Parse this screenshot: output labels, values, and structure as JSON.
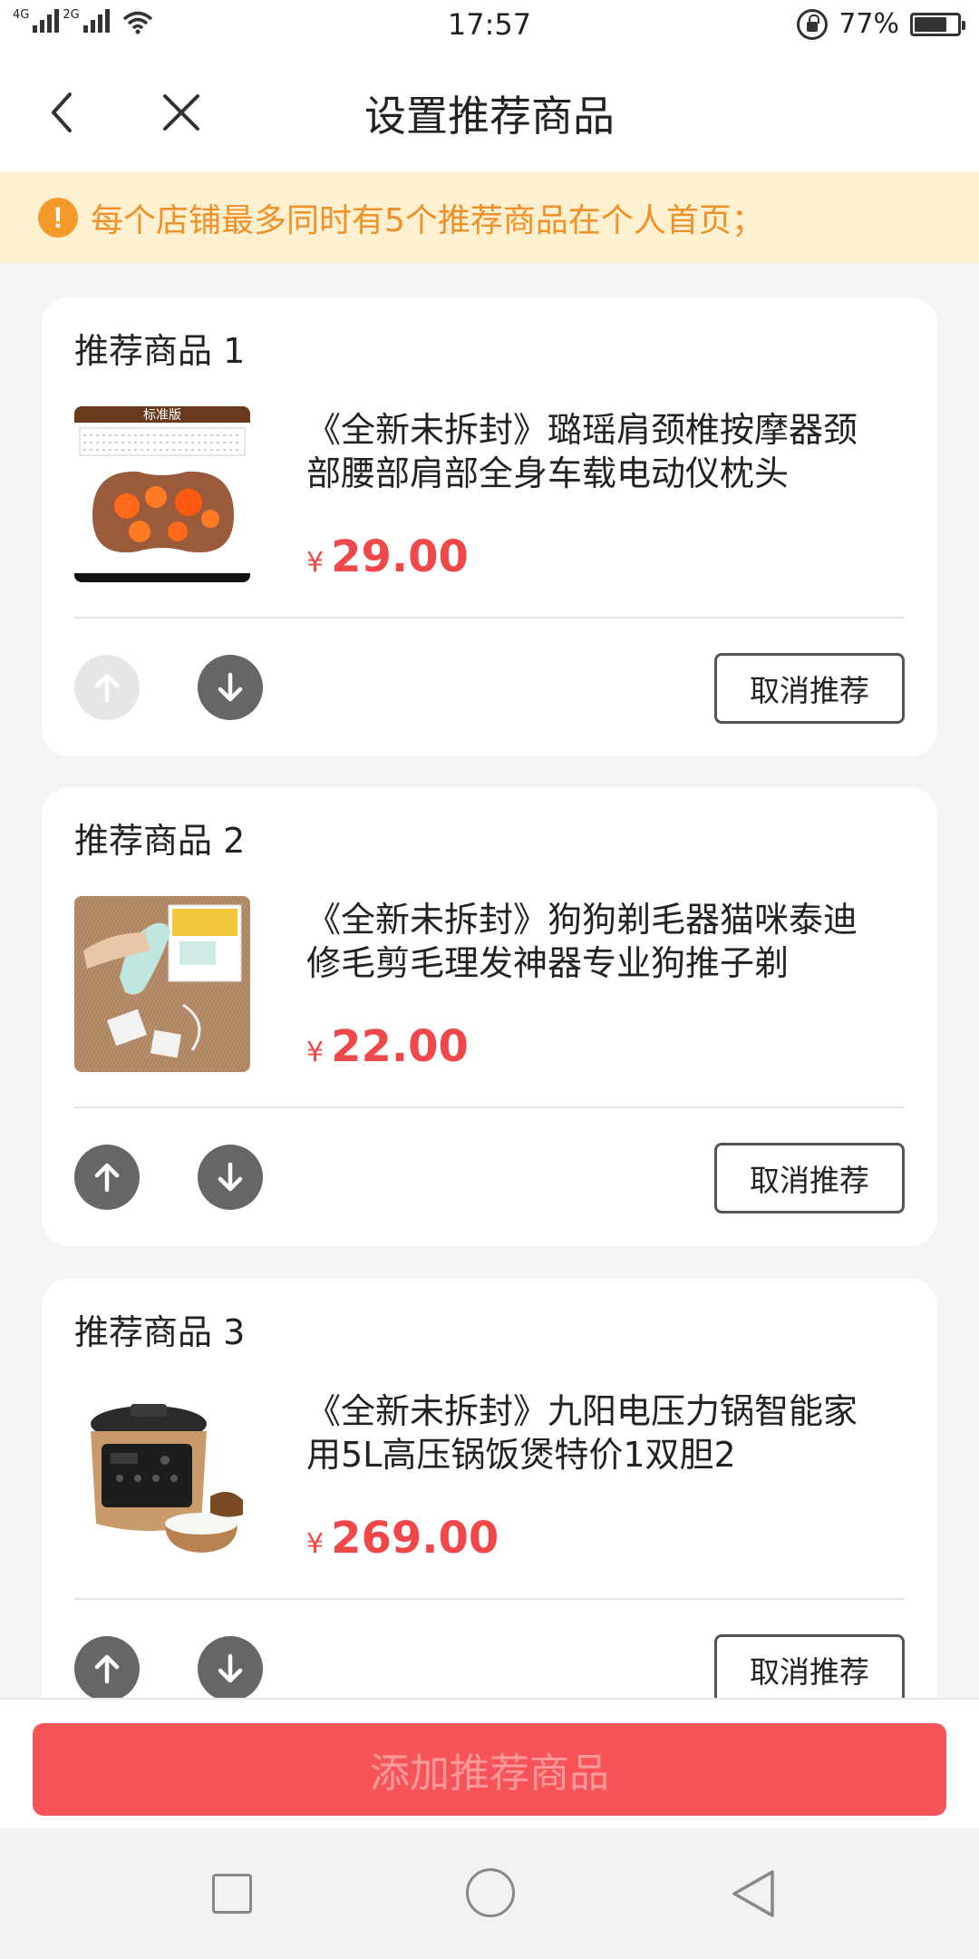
{
  "status_bar": {
    "network_1": "4G",
    "network_2": "2G",
    "time": "17:57",
    "battery_percent": "77%",
    "battery_level": 0.77
  },
  "header": {
    "title": "设置推荐商品"
  },
  "notice": {
    "text": "每个店铺最多同时有5个推荐商品在个人首页；",
    "color": "#f0902a",
    "background": "#fff1cf"
  },
  "products": [
    {
      "label": "推荐商品 1",
      "name_line1": "《全新未拆封》璐瑶肩颈椎按摩器颈",
      "name_line2": "部腰部肩部全身车载电动仪枕头",
      "currency": "¥",
      "price": "29.00",
      "thumb_banner": "标准版",
      "up_enabled": false,
      "down_enabled": true,
      "cancel_label": "取消推荐"
    },
    {
      "label": "推荐商品 2",
      "name_line1": "《全新未拆封》狗狗剃毛器猫咪泰迪",
      "name_line2": "修毛剪毛理发神器专业狗推子剃",
      "currency": "¥",
      "price": "22.00",
      "up_enabled": true,
      "down_enabled": true,
      "cancel_label": "取消推荐"
    },
    {
      "label": "推荐商品 3",
      "name_line1": "《全新未拆封》九阳电压力锅智能家",
      "name_line2": "用5L高压锅饭煲特价1双胆2",
      "currency": "¥",
      "price": "269.00",
      "up_enabled": true,
      "down_enabled": true,
      "cancel_label": "取消推荐"
    }
  ],
  "bottom": {
    "add_button_label": "添加推荐商品",
    "accent_color": "#f7545a"
  },
  "icons": {
    "back": "chevron-left-icon",
    "close": "close-icon",
    "notice": "exclamation-icon",
    "up": "arrow-up-icon",
    "down": "arrow-down-icon",
    "nav_recent": "square-icon",
    "nav_home": "circle-icon",
    "nav_back": "triangle-back-icon"
  }
}
